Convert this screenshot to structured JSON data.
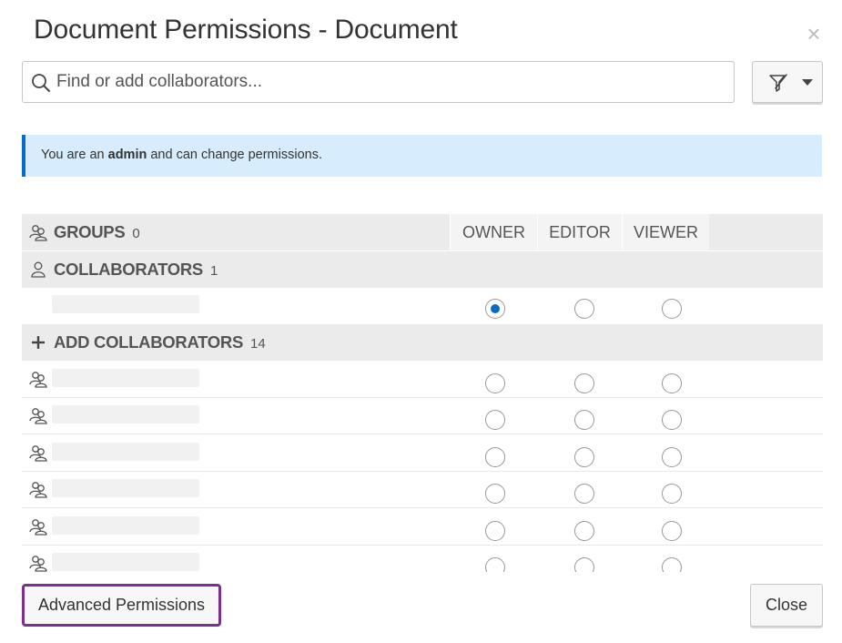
{
  "dialog": {
    "title": "Document Permissions - Document",
    "close_symbol": "×"
  },
  "search": {
    "placeholder": "Find or add collaborators...",
    "value": ""
  },
  "info": {
    "prefix": "You are an ",
    "role": "admin",
    "suffix": " and can change permissions."
  },
  "columns": [
    "OWNER",
    "EDITOR",
    "VIEWER"
  ],
  "groups": {
    "label": "GROUPS",
    "count": "0"
  },
  "collaborators": {
    "label": "COLLABORATORS",
    "count": "1",
    "rows": [
      {
        "selected": "owner"
      }
    ]
  },
  "add_collaborators": {
    "label": "ADD COLLABORATORS",
    "count": "14",
    "visible_rows": 6
  },
  "footer": {
    "advanced_label": "Advanced Permissions",
    "close_label": "Close"
  },
  "colors": {
    "accent": "#0b6ac4",
    "focus_border": "#7b2f8e",
    "banner_bg": "#d7ecfc"
  },
  "icons": {
    "search": "search-icon",
    "filter": "pencil-filter-icon",
    "group": "group-users-icon",
    "user": "user-icon",
    "add": "plus-icon"
  }
}
